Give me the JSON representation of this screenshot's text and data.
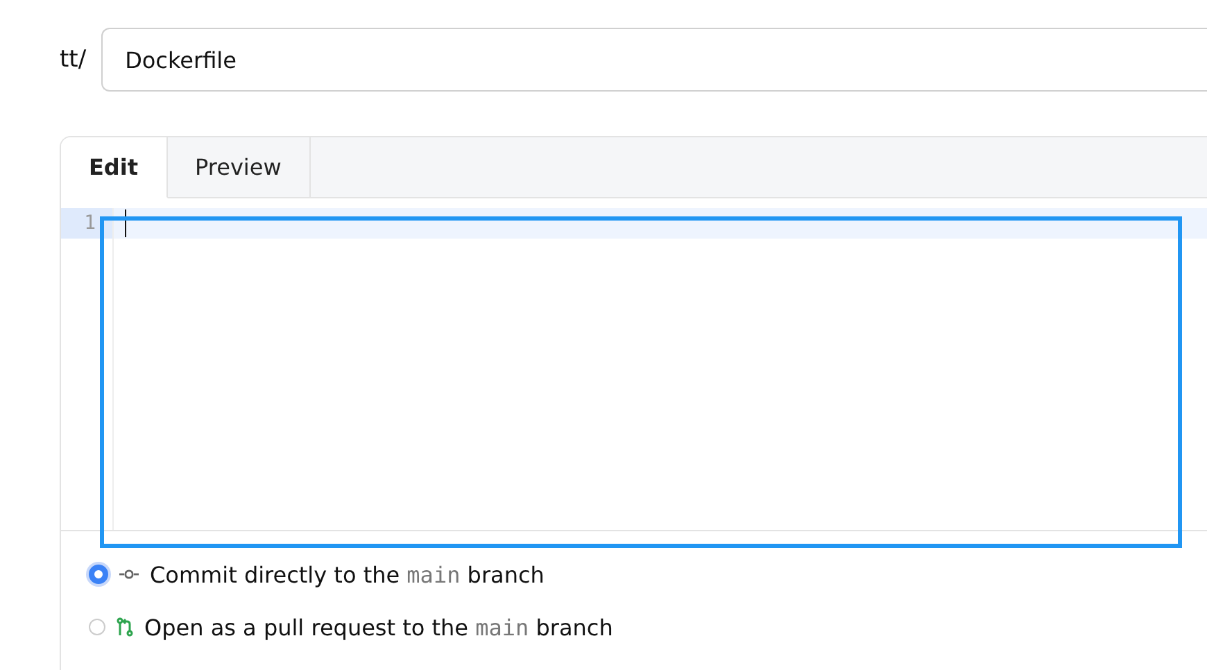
{
  "path": {
    "prefix": "tt/",
    "filename": "Dockerfile"
  },
  "tabs": [
    {
      "label": "Edit",
      "selected": true
    },
    {
      "label": "Preview",
      "selected": false
    }
  ],
  "editor": {
    "line_numbers": [
      "1"
    ]
  },
  "commit_options": [
    {
      "kind": "direct",
      "selected": true,
      "before": "Commit directly to the",
      "branch": "main",
      "after": "branch"
    },
    {
      "kind": "pull-request",
      "selected": false,
      "before": "Open as a pull request to the",
      "branch": "main",
      "after": "branch"
    }
  ]
}
